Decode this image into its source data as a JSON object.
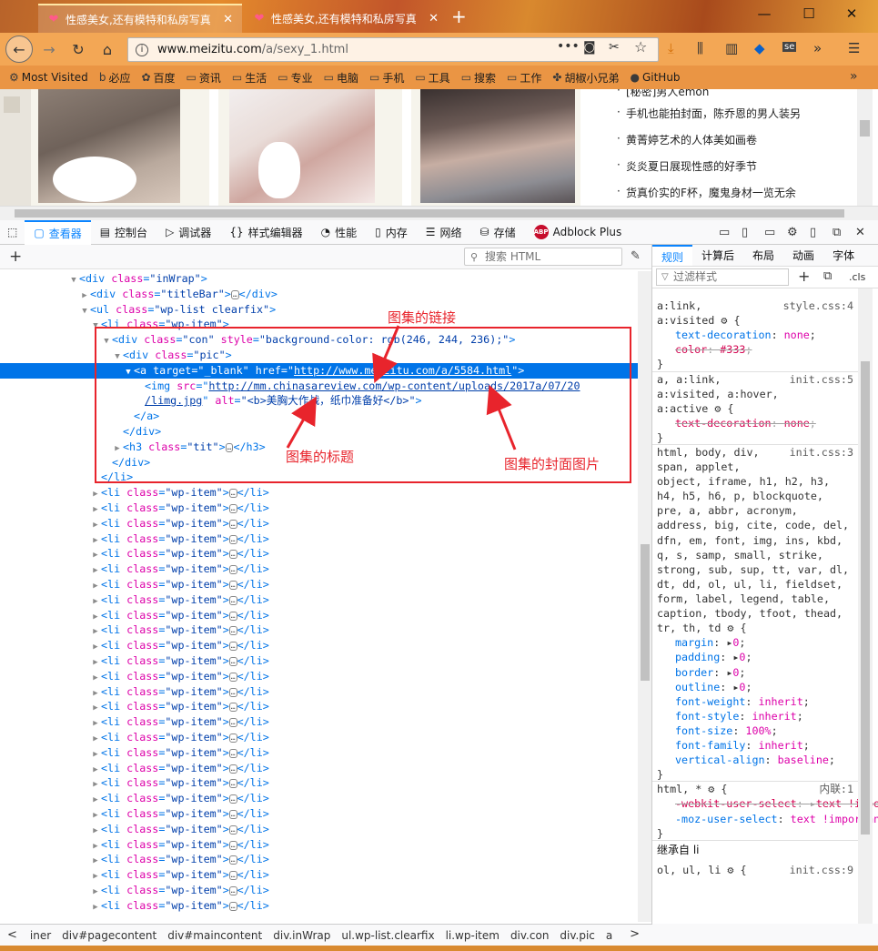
{
  "tabs": [
    {
      "title": "性感美女,还有模特和私房写真",
      "close": "✕"
    },
    {
      "title": "性感美女,还有模特和私房写真",
      "close": "✕"
    }
  ],
  "new_tab": "+",
  "window": {
    "minimize": "—",
    "maximize": "☐",
    "close": "✕"
  },
  "nav": {
    "back": "←",
    "forward": "→",
    "reload": "↻",
    "home": "⌂"
  },
  "url": {
    "host": "www.meizitu.com",
    "path": "/a/sexy_1.html"
  },
  "url_icons": {
    "more": "•••",
    "pocket": "◙",
    "screenshot": "✂",
    "star": "☆"
  },
  "toolbar_icons": {
    "download": "⤓",
    "library": "⫼",
    "sidebar": "▥",
    "gem": "◆",
    "se": "se",
    "overflow": "»",
    "menu": "☰"
  },
  "bookmarks": [
    {
      "label": "Most Visited",
      "icon": "⚙"
    },
    {
      "label": "必应",
      "icon": "b"
    },
    {
      "label": "百度",
      "icon": "✿"
    },
    {
      "label": "资讯",
      "icon": "▭"
    },
    {
      "label": "生活",
      "icon": "▭"
    },
    {
      "label": "专业",
      "icon": "▭"
    },
    {
      "label": "电脑",
      "icon": "▭"
    },
    {
      "label": "手机",
      "icon": "▭"
    },
    {
      "label": "工具",
      "icon": "▭"
    },
    {
      "label": "搜索",
      "icon": "▭"
    },
    {
      "label": "工作",
      "icon": "▭"
    },
    {
      "label": "胡椒小兄弟",
      "icon": "✤"
    },
    {
      "label": "GitHub",
      "icon": "●"
    }
  ],
  "bookmark_overflow": "»",
  "news": [
    "[秘密]男人emon",
    "手机也能拍封面，陈乔恩的男人装另",
    "黄菁婷艺术的人体美如画卷",
    "炎炎夏日展现性感的好季节",
    "货真价实的F杯，魔鬼身材一览无余"
  ],
  "devtools": {
    "tabs": [
      {
        "label": "查看器",
        "icon": "▢"
      },
      {
        "label": "控制台",
        "icon": "▤"
      },
      {
        "label": "调试器",
        "icon": "▷"
      },
      {
        "label": "样式编辑器",
        "icon": "{}"
      },
      {
        "label": "性能",
        "icon": "◔"
      },
      {
        "label": "内存",
        "icon": "▯"
      },
      {
        "label": "网络",
        "icon": "☰"
      },
      {
        "label": "存储",
        "icon": "⛁"
      },
      {
        "label": "Adblock Plus",
        "icon": "ABP"
      }
    ],
    "pick_icon": "⬚",
    "right_icons": [
      "▭",
      "▯",
      "▭",
      "⚙",
      "▯",
      "⧉",
      "✕"
    ]
  },
  "inspector": {
    "add": "+",
    "search_placeholder": "搜索 HTML",
    "pick": "✎",
    "lines": [
      {
        "ind": 76,
        "tw": "▼",
        "seg": [
          [
            "t",
            "<div "
          ],
          [
            "a",
            "class"
          ],
          [
            "t",
            "="
          ],
          [
            "v",
            "\"inWrap\""
          ],
          [
            "t",
            ">"
          ]
        ]
      },
      {
        "ind": 88,
        "tw": "▶",
        "seg": [
          [
            "t",
            "<div "
          ],
          [
            "a",
            "class"
          ],
          [
            "t",
            "="
          ],
          [
            "v",
            "\"titleBar\""
          ],
          [
            "t",
            ">"
          ],
          [
            "d",
            "…"
          ],
          [
            "t",
            "</div>"
          ]
        ]
      },
      {
        "ind": 88,
        "tw": "▼",
        "seg": [
          [
            "t",
            "<ul "
          ],
          [
            "a",
            "class"
          ],
          [
            "t",
            "="
          ],
          [
            "v",
            "\"wp-list clearfix\""
          ],
          [
            "t",
            ">"
          ]
        ]
      },
      {
        "ind": 100,
        "tw": "▼",
        "seg": [
          [
            "t",
            "<li "
          ],
          [
            "a",
            "class"
          ],
          [
            "t",
            "="
          ],
          [
            "v",
            "\"wp-item\""
          ],
          [
            "t",
            ">"
          ]
        ]
      },
      {
        "ind": 112,
        "tw": "▼",
        "seg": [
          [
            "t",
            "<div "
          ],
          [
            "a",
            "class"
          ],
          [
            "t",
            "="
          ],
          [
            "v",
            "\"con\" "
          ],
          [
            "a",
            "style"
          ],
          [
            "t",
            "="
          ],
          [
            "v",
            "\"background-color: rgb(246, 244, 236);\""
          ],
          [
            "t",
            ">"
          ]
        ]
      },
      {
        "ind": 124,
        "tw": "▼",
        "seg": [
          [
            "t",
            "<div "
          ],
          [
            "a",
            "class"
          ],
          [
            "t",
            "="
          ],
          [
            "v",
            "\"pic\""
          ],
          [
            "t",
            ">"
          ]
        ]
      },
      {
        "ind": 136,
        "tw": "▼",
        "sel": true,
        "seg": [
          [
            "t",
            "<a "
          ],
          [
            "a",
            "target"
          ],
          [
            "t",
            "="
          ],
          [
            "v",
            "\"_blank\" "
          ],
          [
            "a",
            "href"
          ],
          [
            "t",
            "=\""
          ],
          [
            "l",
            "http://www.meizitu.com/a/5584.html"
          ],
          [
            "t",
            "\">"
          ]
        ]
      },
      {
        "ind": 148,
        "tw": "",
        "seg": [
          [
            "t",
            "<img "
          ],
          [
            "a",
            "src"
          ],
          [
            "t",
            "=\""
          ],
          [
            "l",
            "http://mm.chinasareview.com/wp-content/uploads/2017a/07/20"
          ]
        ]
      },
      {
        "ind": 148,
        "tw": "",
        "seg": [
          [
            "l",
            "/limg.jpg"
          ],
          [
            "t",
            "\" "
          ],
          [
            "a",
            "alt"
          ],
          [
            "t",
            "="
          ],
          [
            "v",
            "\"<b>美胸大作战，纸巾准备好</b>\""
          ],
          [
            "t",
            ">"
          ]
        ]
      },
      {
        "ind": 136,
        "tw": "",
        "seg": [
          [
            "t",
            "</a>"
          ]
        ]
      },
      {
        "ind": 124,
        "tw": "",
        "seg": [
          [
            "t",
            "</div>"
          ]
        ]
      },
      {
        "ind": 124,
        "tw": "▶",
        "seg": [
          [
            "t",
            "<h3 "
          ],
          [
            "a",
            "class"
          ],
          [
            "t",
            "="
          ],
          [
            "v",
            "\"tit\""
          ],
          [
            "t",
            ">"
          ],
          [
            "d",
            "…"
          ],
          [
            "t",
            "</h3>"
          ]
        ]
      },
      {
        "ind": 112,
        "tw": "",
        "seg": [
          [
            "t",
            "</div>"
          ]
        ]
      },
      {
        "ind": 100,
        "tw": "",
        "seg": [
          [
            "t",
            "</li>"
          ]
        ]
      }
    ],
    "item_line": [
      [
        "t",
        "<li "
      ],
      [
        "a",
        "class"
      ],
      [
        "t",
        "="
      ],
      [
        "v",
        "\"wp-item\""
      ],
      [
        "t",
        ">"
      ],
      [
        "d",
        "…"
      ],
      [
        "t",
        "</li>"
      ]
    ],
    "item_count": 28
  },
  "annotations": {
    "link": "图集的链接",
    "title": "图集的标题",
    "cover": "图集的封面图片"
  },
  "rules_panel": {
    "tabs": [
      "规则",
      "计算后",
      "布局",
      "动画",
      "字体"
    ],
    "filter_placeholder": "过滤样式",
    "add": "+",
    "cls": ".cls",
    "inherit_label": "继承自 li",
    "blocks": [
      {
        "sel": [
          "a:link,",
          "a:visited ⚙ {"
        ],
        "src": "style.css:4",
        "props": [
          {
            "n": "text-decoration",
            "v": "none",
            "s": false
          },
          {
            "n": "color",
            "v": "#333",
            "s": true
          }
        ]
      },
      {
        "sel": [
          "a, a:link,",
          "a:visited, a:hover,",
          "a:active ⚙ {"
        ],
        "src": "init.css:5",
        "props": [
          {
            "n": "text-decoration",
            "v": "none",
            "s": true
          }
        ]
      },
      {
        "sel": [
          "html, body, div,",
          "span, applet,",
          "object, iframe, h1, h2, h3,",
          "h4, h5, h6, p, blockquote,",
          "pre, a, abbr, acronym,",
          "address, big, cite, code, del,",
          "dfn, em, font, img, ins, kbd,",
          "q, s, samp, small, strike,",
          "strong, sub, sup, tt, var, dl,",
          "dt, dd, ol, ul, li, fieldset,",
          "form, label, legend, table,",
          "caption, tbody, tfoot, thead,",
          "tr, th, td ⚙ {"
        ],
        "src": "init.css:3",
        "props": [
          {
            "n": "margin",
            "v": "0",
            "s": false,
            "a": true
          },
          {
            "n": "padding",
            "v": "0",
            "s": false,
            "a": true
          },
          {
            "n": "border",
            "v": "0",
            "s": false,
            "a": true
          },
          {
            "n": "outline",
            "v": "0",
            "s": false,
            "a": true
          },
          {
            "n": "font-weight",
            "v": "inherit",
            "s": false
          },
          {
            "n": "font-style",
            "v": "inherit",
            "s": false
          },
          {
            "n": "font-size",
            "v": "100%",
            "s": false
          },
          {
            "n": "font-family",
            "v": "inherit",
            "s": false
          },
          {
            "n": "vertical-align",
            "v": "baseline",
            "s": false
          }
        ]
      },
      {
        "sel": [
          "html, * ⚙ {"
        ],
        "src": "内联:1",
        "props": [
          {
            "n": "-webkit-user-select",
            "v": "text !important",
            "s": true,
            "a": true
          },
          {
            "n": "-moz-user-select",
            "v": "text !important",
            "s": false
          }
        ]
      }
    ],
    "last_sel": "ol, ul, li ⚙ {",
    "last_src": "init.css:9"
  },
  "breadcrumbs": [
    "iner",
    "div#pagecontent",
    "div#maincontent",
    "div.inWrap",
    "ul.wp-list.clearfix",
    "li.wp-item",
    "div.con",
    "div.pic",
    "a"
  ],
  "crumb_prev": "<",
  "crumb_next": ">",
  "colors": {
    "accent": "#0a84ff",
    "selection": "#0074e8",
    "annotation": "#e8242c"
  }
}
